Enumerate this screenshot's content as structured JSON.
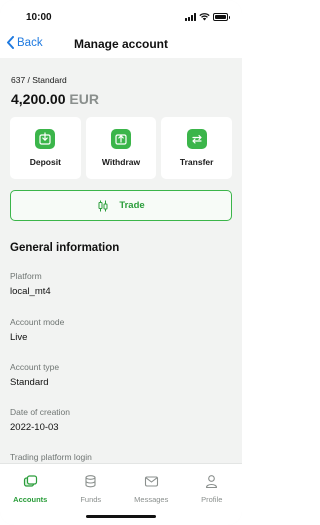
{
  "status_bar": {
    "time": "10:00"
  },
  "nav": {
    "back_label": "Back",
    "title": "Manage account"
  },
  "account": {
    "id_line": "637 / Standard",
    "balance_amount": "4,200.00",
    "balance_currency": "EUR"
  },
  "actions": [
    {
      "label": "Deposit",
      "icon": "deposit-icon"
    },
    {
      "label": "Withdraw",
      "icon": "withdraw-icon"
    },
    {
      "label": "Transfer",
      "icon": "transfer-icon"
    }
  ],
  "trade": {
    "label": "Trade",
    "icon": "candlestick-icon"
  },
  "general_info": {
    "title": "General information",
    "fields": [
      {
        "label": "Platform",
        "value": "local_mt4"
      },
      {
        "label": "Account mode",
        "value": "Live"
      },
      {
        "label": "Account type",
        "value": "Standard"
      },
      {
        "label": "Date of creation",
        "value": "2022-10-03"
      },
      {
        "label": "Trading platform login",
        "value": ""
      }
    ]
  },
  "tabs": [
    {
      "label": "Accounts",
      "icon": "accounts-icon",
      "active": true
    },
    {
      "label": "Funds",
      "icon": "funds-icon",
      "active": false
    },
    {
      "label": "Messages",
      "icon": "messages-icon",
      "active": false
    },
    {
      "label": "Profile",
      "icon": "profile-icon",
      "active": false
    }
  ],
  "colors": {
    "accent": "#3bb54a",
    "link": "#1f7ae0",
    "background": "#f2f3f2"
  }
}
